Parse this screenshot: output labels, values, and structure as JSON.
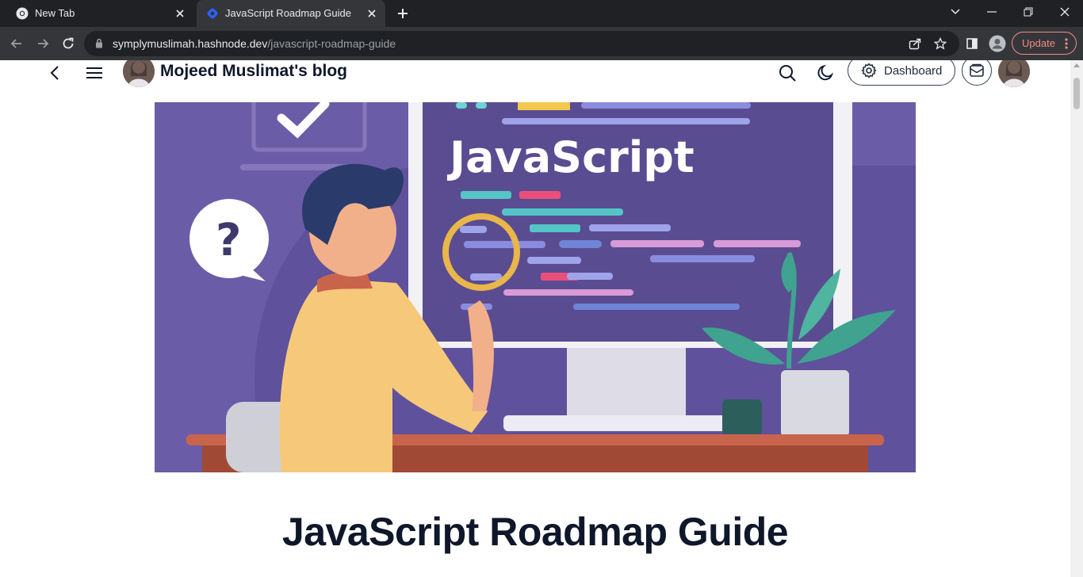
{
  "browser": {
    "tabs": [
      {
        "title": "New Tab",
        "active": false
      },
      {
        "title": "JavaScript Roadmap Guide",
        "active": true
      }
    ],
    "url_domain": "symplymuslimah.hashnode.dev",
    "url_path": "/javascript-roadmap-guide",
    "update_label": "Update"
  },
  "blog": {
    "title": "Mojeed Muslimat's blog",
    "dashboard_label": "Dashboard"
  },
  "article": {
    "cover_text": "JavaScript",
    "title": "JavaScript Roadmap Guide"
  },
  "colors": {
    "chrome_dark": "#202124",
    "chrome_toolbar": "#35363a",
    "update_accent": "#f28b82",
    "cover_purple": "#6b5ca8",
    "text_dark": "#0f172a"
  }
}
